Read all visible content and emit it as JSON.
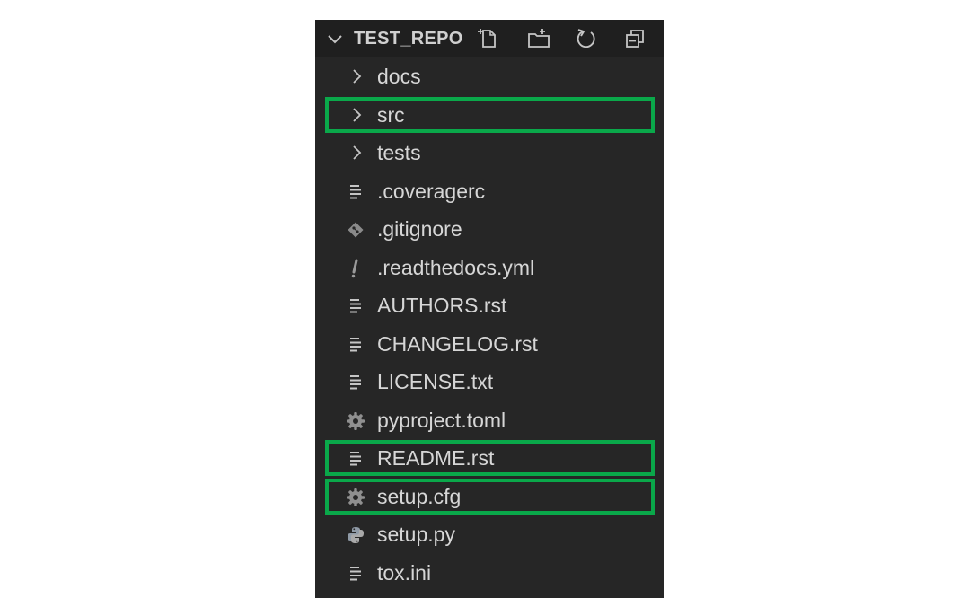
{
  "explorer": {
    "title": "TEST_REPO",
    "actions": [
      {
        "name": "new-file",
        "icon": "new-file-icon"
      },
      {
        "name": "new-folder",
        "icon": "new-folder-icon"
      },
      {
        "name": "refresh",
        "icon": "refresh-icon"
      },
      {
        "name": "collapse-all",
        "icon": "collapse-all-icon"
      }
    ],
    "items": [
      {
        "label": "docs",
        "type": "folder",
        "icon": "chevron-right-icon",
        "highlighted": false
      },
      {
        "label": "src",
        "type": "folder",
        "icon": "chevron-right-icon",
        "highlighted": true
      },
      {
        "label": "tests",
        "type": "folder",
        "icon": "chevron-right-icon",
        "highlighted": false
      },
      {
        "label": ".coveragerc",
        "type": "file",
        "icon": "text-lines-icon",
        "highlighted": false
      },
      {
        "label": ".gitignore",
        "type": "file",
        "icon": "git-icon",
        "highlighted": false
      },
      {
        "label": ".readthedocs.yml",
        "type": "file",
        "icon": "exclamation-icon",
        "highlighted": false
      },
      {
        "label": "AUTHORS.rst",
        "type": "file",
        "icon": "text-lines-icon",
        "highlighted": false
      },
      {
        "label": "CHANGELOG.rst",
        "type": "file",
        "icon": "text-lines-icon",
        "highlighted": false
      },
      {
        "label": "LICENSE.txt",
        "type": "file",
        "icon": "text-lines-icon",
        "highlighted": false
      },
      {
        "label": "pyproject.toml",
        "type": "file",
        "icon": "gear-icon",
        "highlighted": false
      },
      {
        "label": "README.rst",
        "type": "file",
        "icon": "text-lines-icon",
        "highlighted": true
      },
      {
        "label": "setup.cfg",
        "type": "file",
        "icon": "gear-icon",
        "highlighted": true
      },
      {
        "label": "setup.py",
        "type": "file",
        "icon": "python-icon",
        "highlighted": false
      },
      {
        "label": "tox.ini",
        "type": "file",
        "icon": "text-lines-icon",
        "highlighted": false
      }
    ]
  },
  "colors": {
    "panel_background": "#262626",
    "header_background": "#1f1f1f",
    "text": "#d6d6d6",
    "icon": "#c5c5c5",
    "highlight_border": "#0aa84a"
  }
}
